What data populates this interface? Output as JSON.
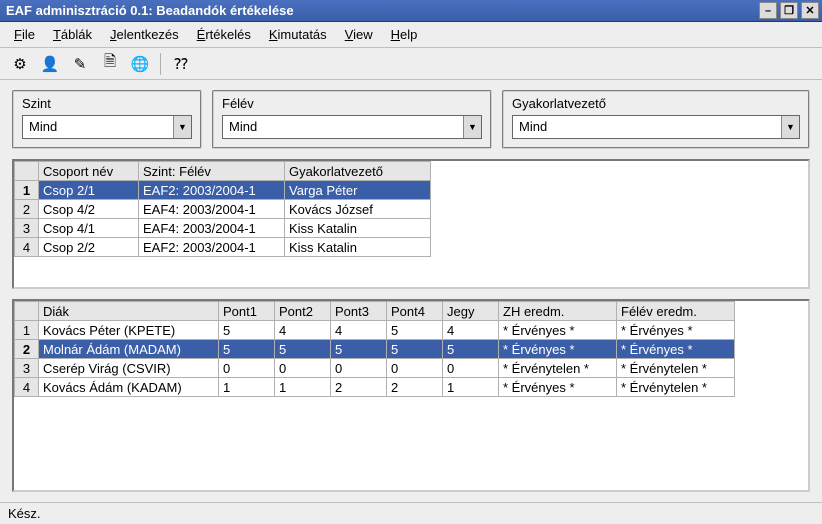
{
  "window": {
    "title": "EAF adminisztráció 0.1: Beadandók értékelése",
    "min_tip": "–",
    "max_tip": "❐",
    "close_tip": "✕"
  },
  "menu": {
    "file": "File",
    "file_u": "F",
    "tablak": "Táblák",
    "tablak_u": "T",
    "jelentkezes": "Jelentkezés",
    "jelentkezes_u": "J",
    "ertekeles": "Értékelés",
    "ertekeles_u": "É",
    "kimutatas": "Kimutatás",
    "kimutatas_u": "K",
    "view": "View",
    "view_u": "V",
    "help": "Help",
    "help_u": "H"
  },
  "toolbar": {
    "icons": [
      "settings-icon",
      "user-icon",
      "edit-icon",
      "report-icon",
      "globe-icon",
      "help-icon"
    ]
  },
  "filters": {
    "szint": {
      "label": "Szint",
      "value": "Mind"
    },
    "felev": {
      "label": "Félév",
      "value": "Mind"
    },
    "gyak": {
      "label": "Gyakorlatvezető",
      "value": "Mind"
    }
  },
  "groups": {
    "headers": [
      "",
      "Csoport név",
      "Szint: Félév",
      "Gyakorlatvezető"
    ],
    "rows": [
      {
        "n": "1",
        "nev": "Csop 2/1",
        "szf": "EAF2: 2003/2004-1",
        "gyv": "Varga Péter",
        "selected": true
      },
      {
        "n": "2",
        "nev": "Csop 4/2",
        "szf": "EAF4: 2003/2004-1",
        "gyv": "Kovács József",
        "selected": false
      },
      {
        "n": "3",
        "nev": "Csop 4/1",
        "szf": "EAF4: 2003/2004-1",
        "gyv": "Kiss Katalin",
        "selected": false
      },
      {
        "n": "4",
        "nev": "Csop 2/2",
        "szf": "EAF2: 2003/2004-1",
        "gyv": "Kiss Katalin",
        "selected": false
      }
    ]
  },
  "students": {
    "headers": [
      "",
      "Diák",
      "Pont1",
      "Pont2",
      "Pont3",
      "Pont4",
      "Jegy",
      "ZH eredm.",
      "Félév eredm."
    ],
    "rows": [
      {
        "n": "1",
        "diak": "Kovács Péter (KPETE)",
        "p1": "5",
        "p2": "4",
        "p3": "4",
        "p4": "5",
        "jegy": "4",
        "zh": "* Érvényes *",
        "fe": "* Érvényes *",
        "selected": false
      },
      {
        "n": "2",
        "diak": "Molnár Ádám (MADAM)",
        "p1": "5",
        "p2": "5",
        "p3": "5",
        "p4": "5",
        "jegy": "5",
        "zh": "* Érvényes *",
        "fe": "* Érvényes *",
        "selected": true
      },
      {
        "n": "3",
        "diak": "Cserép Virág (CSVIR)",
        "p1": "0",
        "p2": "0",
        "p3": "0",
        "p4": "0",
        "jegy": "0",
        "zh": "* Érvénytelen *",
        "fe": "* Érvénytelen *",
        "selected": false
      },
      {
        "n": "4",
        "diak": "Kovács Ádám (KADAM)",
        "p1": "1",
        "p2": "1",
        "p3": "2",
        "p4": "2",
        "jegy": "1",
        "zh": "* Érvényes *",
        "fe": "* Érvénytelen *",
        "selected": false
      }
    ]
  },
  "status": {
    "text": "Kész."
  }
}
